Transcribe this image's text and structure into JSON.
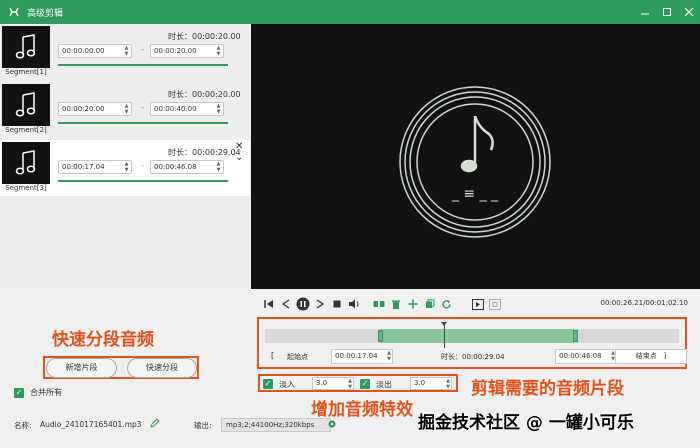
{
  "window": {
    "title": "高级剪辑",
    "accent": "#2e9a5c",
    "annotation_color": "#e0541c"
  },
  "segments": [
    {
      "label": "Segment[1]",
      "duration": "时长：00:00:20.00",
      "start": "00:00:00.00",
      "end": "00:00:20.00",
      "progress": 1.0
    },
    {
      "label": "Segment[2]",
      "duration": "时长：00:00:20.00",
      "start": "00:00:20.00",
      "end": "00:00:40.00",
      "progress": 1.0
    },
    {
      "label": "Segment[3]",
      "duration": "时长：00:00:29.04",
      "start": "00:00:17.04",
      "end": "00:00:46.08",
      "progress": 1.0
    }
  ],
  "preview": {
    "status_text": "_ ≡ _ _"
  },
  "controls": {
    "time": "00:00:26.21/00:01:02.10"
  },
  "timeline": {
    "start_label": "起始点",
    "start_value": "00:00:17.04",
    "duration_label": "时长：00:00:29.04",
    "end_value": "00:00:46.08",
    "end_label": "结束点"
  },
  "buttons": {
    "new_segment": "新增片段",
    "quick_split": "快速分段"
  },
  "merge_all": "合并所有",
  "effects": {
    "fade_in_label": "淡入",
    "fade_in_value": "3.0",
    "fade_out_label": "淡出",
    "fade_out_value": "3.0"
  },
  "file": {
    "name_label": "名称:",
    "name": "Audio_241017165401.mp3",
    "output_label": "输出:",
    "output": "mp3;2;44100Hz;320kbps"
  },
  "annotations": {
    "quick_split": "快速分段音频",
    "clip_segment": "剪辑需要的音频片段",
    "add_effect": "增加音频特效"
  },
  "watermark": "掘金技术社区 @ 一罐小可乐"
}
